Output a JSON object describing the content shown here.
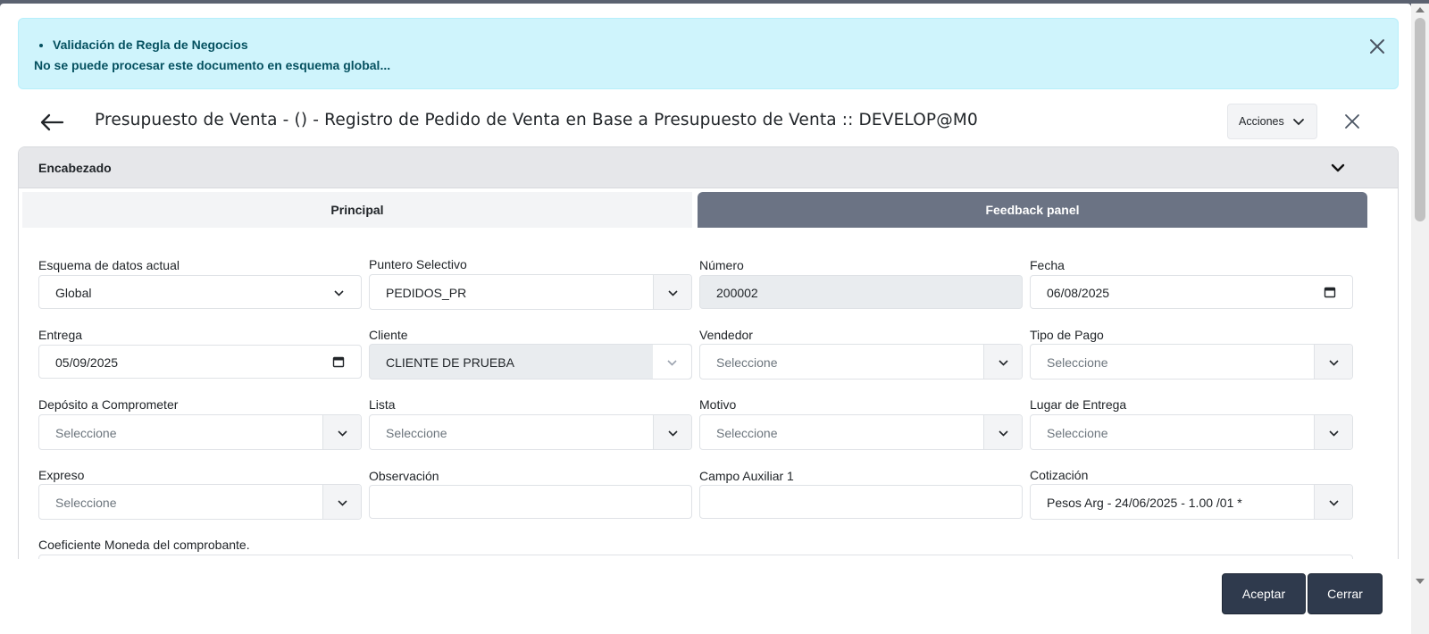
{
  "alert": {
    "bullet": "Validación de Regla de Negocios",
    "message": "No se puede procesar este documento en esquema global..."
  },
  "header": {
    "title": "Presupuesto de Venta - () - Registro de Pedido de Venta en Base a Presupuesto de Venta :: DEVELOP@M0",
    "actions_label": "Acciones"
  },
  "panel": {
    "title": "Encabezado",
    "tabs": [
      {
        "label": "Principal",
        "active": false
      },
      {
        "label": "Feedback panel",
        "active": true
      }
    ]
  },
  "fields": {
    "esquema": {
      "label": "Esquema de datos actual",
      "value": "Global"
    },
    "puntero": {
      "label": "Puntero Selectivo",
      "value": "PEDIDOS_PR"
    },
    "numero": {
      "label": "Número",
      "value": "200002"
    },
    "fecha": {
      "label": "Fecha",
      "value": "06/08/2025"
    },
    "entrega": {
      "label": "Entrega",
      "value": "05/09/2025"
    },
    "cliente": {
      "label": "Cliente",
      "value": "CLIENTE DE PRUEBA"
    },
    "vendedor": {
      "label": "Vendedor",
      "placeholder": "Seleccione"
    },
    "tipo_pago": {
      "label": "Tipo de Pago",
      "placeholder": "Seleccione"
    },
    "deposito": {
      "label": "Depósito a Comprometer",
      "placeholder": "Seleccione"
    },
    "lista": {
      "label": "Lista",
      "placeholder": "Seleccione"
    },
    "motivo": {
      "label": "Motivo",
      "placeholder": "Seleccione"
    },
    "lugar_entrega": {
      "label": "Lugar de Entrega",
      "placeholder": "Seleccione"
    },
    "expreso": {
      "label": "Expreso",
      "placeholder": "Seleccione"
    },
    "observacion": {
      "label": "Observación",
      "value": ""
    },
    "campo_aux": {
      "label": "Campo Auxiliar 1",
      "value": ""
    },
    "cotizacion": {
      "label": "Cotización",
      "value": "Pesos Arg - 24/06/2025 - 1.00 /01 *"
    },
    "coeficiente": {
      "label": "Coeficiente Moneda del comprobante."
    }
  },
  "footer": {
    "accept_label": "Aceptar",
    "close_label": "Cerrar"
  },
  "colors": {
    "alert_bg": "#cff4fc",
    "alert_text": "#055160",
    "tab_active": "#6b7384",
    "button_dark": "#2f3a4d"
  }
}
